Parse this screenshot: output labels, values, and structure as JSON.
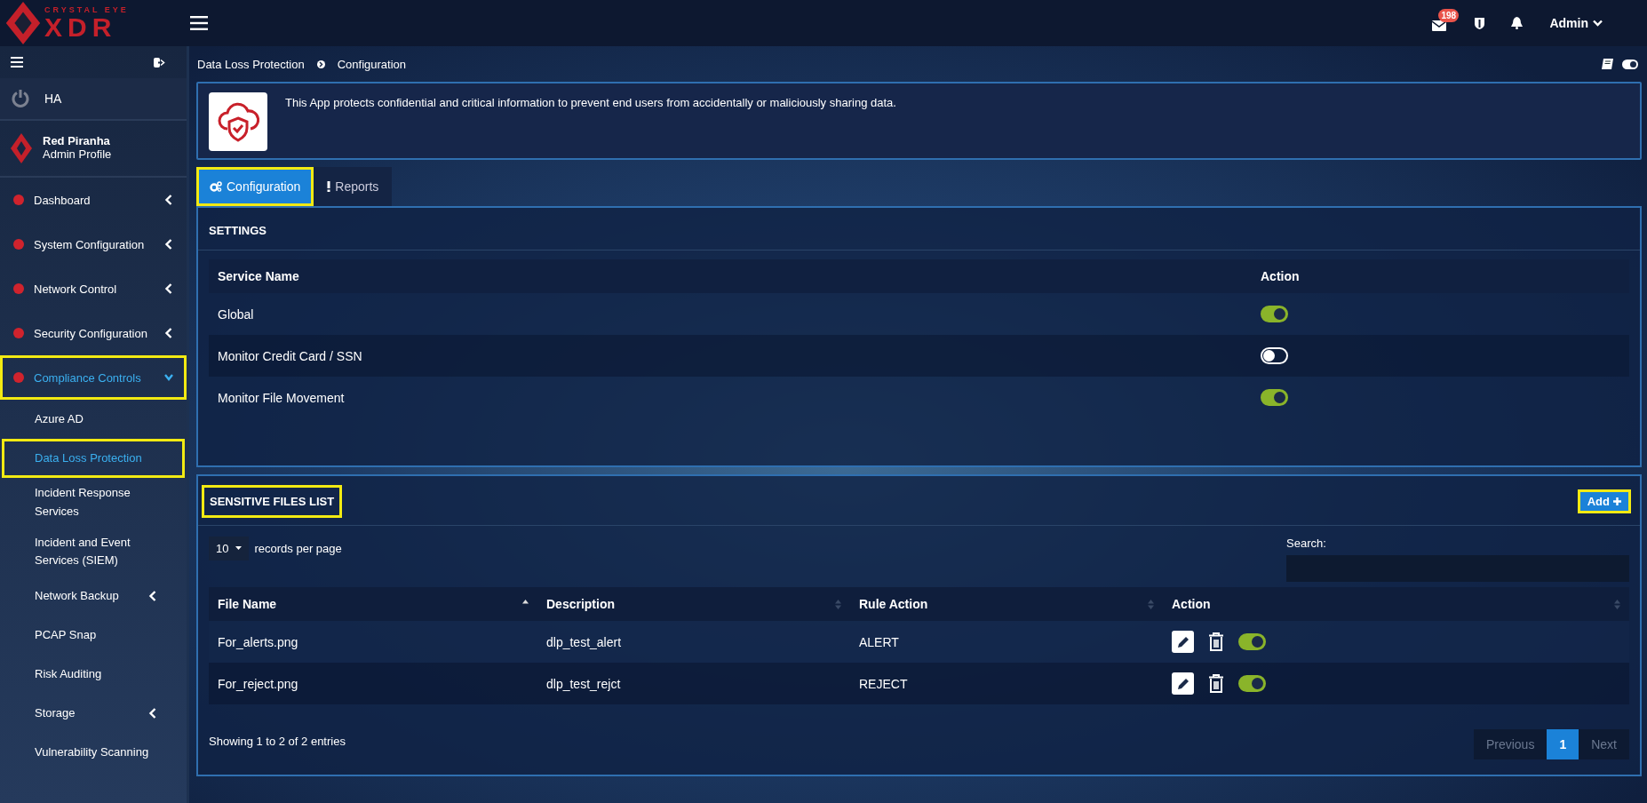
{
  "logo": {
    "top": "CRYSTAL EYE",
    "main": "XDR"
  },
  "topbar": {
    "mail_badge": "198",
    "user": "Admin"
  },
  "sidebar": {
    "ha_label": "HA",
    "profile": {
      "name": "Red Piranha",
      "role": "Admin Profile"
    },
    "items": [
      {
        "label": "Dashboard",
        "kind": "group",
        "expanded": false,
        "selected": false,
        "highlighted": false
      },
      {
        "label": "System Configuration",
        "kind": "group",
        "expanded": false,
        "selected": false,
        "highlighted": false
      },
      {
        "label": "Network Control",
        "kind": "group",
        "expanded": false,
        "selected": false,
        "highlighted": false
      },
      {
        "label": "Security Configuration",
        "kind": "group",
        "expanded": false,
        "selected": false,
        "highlighted": false
      },
      {
        "label": "Compliance Controls",
        "kind": "group",
        "expanded": true,
        "selected": true,
        "highlighted": true,
        "children": [
          {
            "label": "Azure AD",
            "kind": "link",
            "selected": false,
            "highlighted": false
          },
          {
            "label": "Data Loss Protection",
            "kind": "link",
            "selected": true,
            "highlighted": true
          },
          {
            "label": "Incident Response Services",
            "kind": "link",
            "selected": false,
            "highlighted": false
          },
          {
            "label": "Incident and Event Services (SIEM)",
            "kind": "link",
            "selected": false,
            "highlighted": false
          },
          {
            "label": "Network Backup",
            "kind": "group",
            "expanded": false,
            "selected": false,
            "highlighted": false
          },
          {
            "label": "PCAP Snap",
            "kind": "link",
            "selected": false,
            "highlighted": false
          },
          {
            "label": "Risk Auditing",
            "kind": "link",
            "selected": false,
            "highlighted": false
          },
          {
            "label": "Storage",
            "kind": "group",
            "expanded": false,
            "selected": false,
            "highlighted": false
          },
          {
            "label": "Vulnerability Scanning",
            "kind": "link",
            "selected": false,
            "highlighted": false
          }
        ]
      }
    ]
  },
  "breadcrumb": [
    "Data Loss Protection",
    "Configuration"
  ],
  "app_description": "This App protects confidential and critical information to prevent end users from accidentally or maliciously sharing data.",
  "tabs": [
    {
      "label": "Configuration",
      "selected": true,
      "highlighted": true
    },
    {
      "label": "Reports",
      "selected": false,
      "highlighted": false
    }
  ],
  "settings": {
    "title": "SETTINGS",
    "columns": [
      "Service Name",
      "Action"
    ],
    "rows": [
      {
        "name": "Global",
        "on": true
      },
      {
        "name": "Monitor Credit Card / SSN",
        "on": false
      },
      {
        "name": "Monitor File Movement",
        "on": true
      }
    ]
  },
  "sensitive_files": {
    "title": "SENSITIVE FILES LIST",
    "title_highlighted": true,
    "add_button": "Add",
    "add_highlighted": true,
    "page_size": "10",
    "page_size_label": "records per page",
    "search_label": "Search:",
    "columns": [
      {
        "label": "File Name",
        "sorted": true
      },
      {
        "label": "Description",
        "sorted": false
      },
      {
        "label": "Rule Action",
        "sorted": false
      },
      {
        "label": "Action",
        "sorted": false
      }
    ],
    "rows": [
      {
        "file": "For_alerts.png",
        "description": "dlp_test_alert",
        "rule_action": "ALERT",
        "on": true
      },
      {
        "file": "For_reject.png",
        "description": "dlp_test_rejct",
        "rule_action": "REJECT",
        "on": true
      }
    ],
    "info": "Showing 1 to 2 of 2 entries",
    "pagination": [
      {
        "label": "Previous",
        "selected": false
      },
      {
        "label": "1",
        "selected": true
      },
      {
        "label": "Next",
        "selected": false
      }
    ]
  }
}
